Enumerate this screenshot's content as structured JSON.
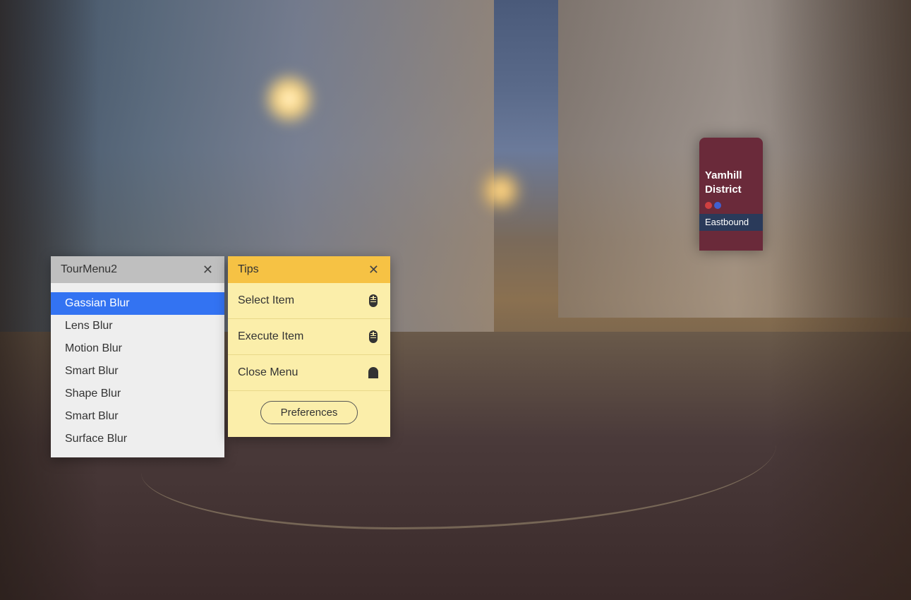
{
  "background": {
    "sign": {
      "line1": "Yamhill",
      "line2": "District",
      "direction": "Eastbound"
    }
  },
  "tourMenu": {
    "title": "TourMenu2",
    "items": [
      {
        "label": "Gassian Blur",
        "selected": true
      },
      {
        "label": "Lens Blur",
        "selected": false
      },
      {
        "label": "Motion Blur",
        "selected": false
      },
      {
        "label": "Smart Blur",
        "selected": false
      },
      {
        "label": "Shape Blur",
        "selected": false
      },
      {
        "label": "Smart Blur",
        "selected": false
      },
      {
        "label": "Surface Blur",
        "selected": false
      }
    ]
  },
  "tips": {
    "title": "Tips",
    "items": [
      {
        "label": "Select Item",
        "icon": "mouse-scroll"
      },
      {
        "label": "Execute Item",
        "icon": "mouse-click"
      },
      {
        "label": "Close Menu",
        "icon": "arch"
      }
    ],
    "preferences_label": "Preferences"
  }
}
